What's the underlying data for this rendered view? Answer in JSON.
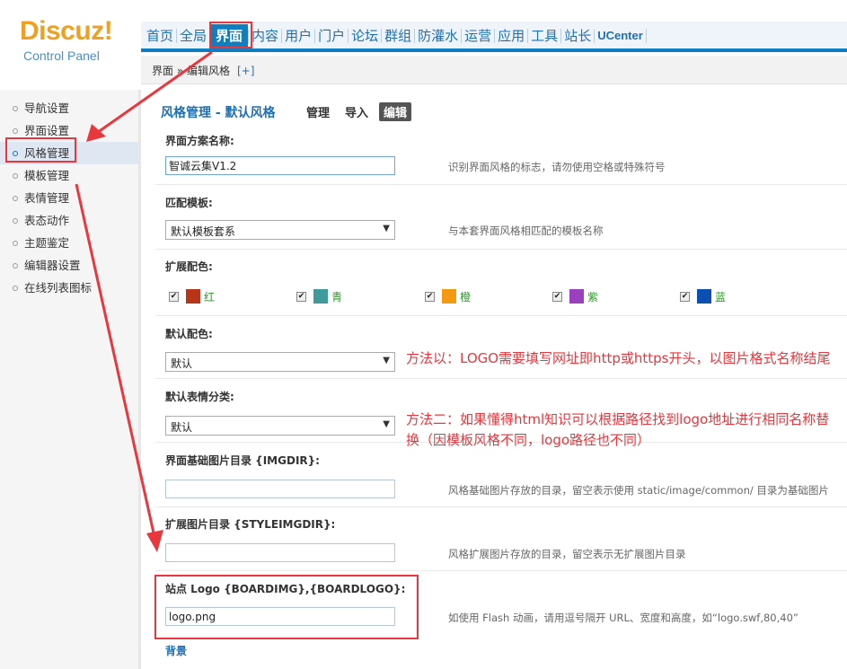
{
  "header": {
    "logo_text": "Discuz!",
    "logo_sub": "Control Panel",
    "nav": [
      {
        "label": "首页"
      },
      {
        "label": "全局"
      },
      {
        "label": "界面",
        "active": true
      },
      {
        "label": "内容"
      },
      {
        "label": "用户"
      },
      {
        "label": "门户"
      },
      {
        "label": "论坛"
      },
      {
        "label": "群组"
      },
      {
        "label": "防灌水"
      },
      {
        "label": "运营"
      },
      {
        "label": "应用"
      },
      {
        "label": "工具"
      },
      {
        "label": "站长"
      },
      {
        "label": "UCenter"
      }
    ]
  },
  "breadcrumb": {
    "text": "界面 » 编辑风格",
    "add": "[+]"
  },
  "sidebar": {
    "items": [
      {
        "label": "导航设置"
      },
      {
        "label": "界面设置"
      },
      {
        "label": "风格管理",
        "active": true
      },
      {
        "label": "模板管理"
      },
      {
        "label": "表情管理"
      },
      {
        "label": "表态动作"
      },
      {
        "label": "主题鉴定"
      },
      {
        "label": "编辑器设置"
      },
      {
        "label": "在线列表图标"
      }
    ]
  },
  "main": {
    "title": "风格管理 - 默认风格",
    "tabs": [
      {
        "label": "管理"
      },
      {
        "label": "导入"
      },
      {
        "label": "编辑",
        "active": true
      }
    ],
    "fields": {
      "scheme_name": {
        "label": "界面方案名称:",
        "value": "智诚云集V1.2",
        "hint": "识别界面风格的标志，请勿使用空格或特殊符号"
      },
      "template": {
        "label": "匹配模板:",
        "value": "默认模板套系",
        "hint": "与本套界面风格相匹配的模板名称"
      },
      "ext_colors": {
        "label": "扩展配色:",
        "items": [
          {
            "name": "红",
            "color": "#b8351a"
          },
          {
            "name": "青",
            "color": "#3f9a9c"
          },
          {
            "name": "橙",
            "color": "#f39a10"
          },
          {
            "name": "紫",
            "color": "#9a3fbd"
          },
          {
            "name": "蓝",
            "color": "#0b4fb3"
          }
        ]
      },
      "default_color": {
        "label": "默认配色:",
        "value": "默认"
      },
      "default_smiley": {
        "label": "默认表情分类:",
        "value": "默认"
      },
      "imgdir": {
        "label": "界面基础图片目录 {IMGDIR}:",
        "value": "",
        "hint": "风格基础图片存放的目录，留空表示使用 static/image/common/ 目录为基础图片"
      },
      "styleimgdir": {
        "label": "扩展图片目录 {STYLEIMGDIR}:",
        "value": "",
        "hint": "风格扩展图片存放的目录，留空表示无扩展图片目录"
      },
      "logo": {
        "label": "站点 Logo {BOARDIMG},{BOARDLOGO}:",
        "value": "logo.png",
        "hint": "如使用 Flash 动画，请用逗号隔开 URL、宽度和高度，如“logo.swf,80,40”"
      },
      "section_background": "背景"
    }
  },
  "annotations": {
    "method1": "方法以：LOGO需要填写网址即http或https开头，以图片格式名称结尾",
    "method2": "方法二：如果懂得html知识可以根据路径找到logo地址进行相同名称替换（因模板风格不同，logo路径也不同）",
    "highlight_color": "#e8373d"
  }
}
